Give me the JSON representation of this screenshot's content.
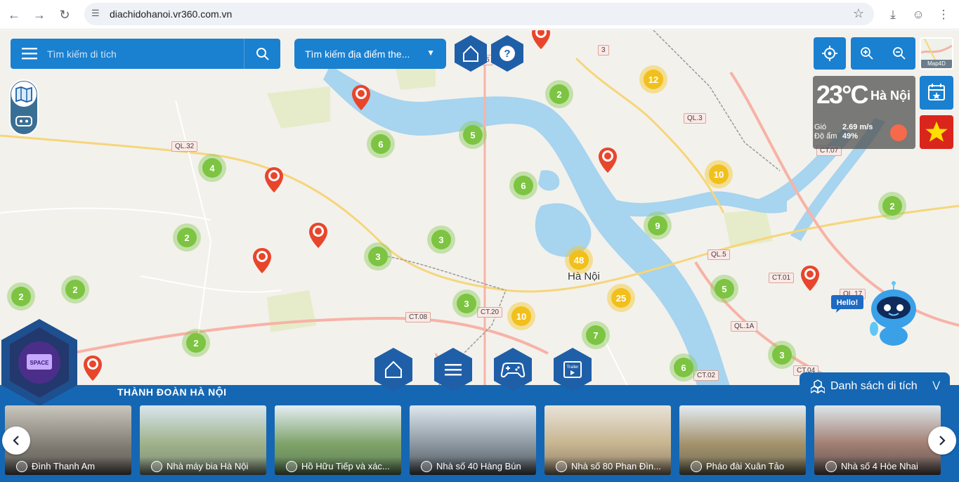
{
  "browser": {
    "url": "diachidohanoi.vr360.com.vn"
  },
  "search": {
    "placeholder": "Tìm kiếm di tích"
  },
  "location_search": {
    "label": "Tìm kiếm địa điểm the..."
  },
  "weather": {
    "temperature": "23°C",
    "city": "Hà Nội",
    "wind_label": "Gió",
    "wind_value": "2.69 m/s",
    "humidity_label": "Độ ẩm",
    "humidity_value": "49%"
  },
  "map": {
    "map4d_label": "Map4D",
    "city_label": "Hà Nội",
    "road_labels": [
      "QL.32",
      "QL.3",
      "QL.5",
      "CT.01",
      "CT.08",
      "CT.20",
      "QL.1A",
      "CT.07",
      "QL.17",
      "CT.02",
      "CT.04",
      "5",
      "3"
    ],
    "clusters": [
      {
        "count": "12",
        "color": "yellow"
      },
      {
        "count": "2",
        "color": "green"
      },
      {
        "count": "5",
        "color": "green"
      },
      {
        "count": "6",
        "color": "green"
      },
      {
        "count": "4",
        "color": "green"
      },
      {
        "count": "10",
        "color": "yellow"
      },
      {
        "count": "6",
        "color": "green"
      },
      {
        "count": "2",
        "color": "green"
      },
      {
        "count": "9",
        "color": "green"
      },
      {
        "count": "2",
        "color": "green"
      },
      {
        "count": "3",
        "color": "green"
      },
      {
        "count": "3",
        "color": "green"
      },
      {
        "count": "48",
        "color": "yellow"
      },
      {
        "count": "2",
        "color": "green"
      },
      {
        "count": "2",
        "color": "green"
      },
      {
        "count": "5",
        "color": "green"
      },
      {
        "count": "25",
        "color": "yellow"
      },
      {
        "count": "3",
        "color": "green"
      },
      {
        "count": "10",
        "color": "yellow"
      },
      {
        "count": "7",
        "color": "green"
      },
      {
        "count": "2",
        "color": "green"
      },
      {
        "count": "3",
        "color": "green"
      },
      {
        "count": "6",
        "color": "green"
      }
    ]
  },
  "hello_bubble": "Hello!",
  "bottom": {
    "title": "THÀNH ĐOÀN HÀ NỘI",
    "list_toggle": "Danh sách di tích",
    "space_label": "SPACE",
    "trailer_label": "Trailer",
    "cards": [
      {
        "name": "Đình Thanh Am"
      },
      {
        "name": "Nhà máy bia Hà Nội"
      },
      {
        "name": "Hồ Hữu Tiếp và xác..."
      },
      {
        "name": "Nhà số 40 Hàng Bún"
      },
      {
        "name": "Nhà số 80 Phan Đìn..."
      },
      {
        "name": "Pháo đài Xuân Tảo"
      },
      {
        "name": "Nhà số 4 Hòe Nhai"
      }
    ]
  },
  "colors": {
    "primary": "#1a80d0",
    "bar": "#1567b3",
    "cluster_green": "#7cc441",
    "cluster_yellow": "#f2c01c",
    "pin": "#e8462c"
  }
}
